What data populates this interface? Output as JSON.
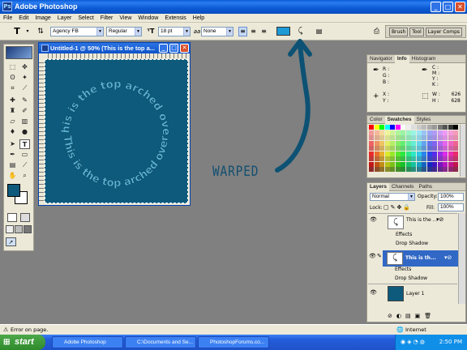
{
  "window": {
    "title": "Adobe Photoshop",
    "min": "_",
    "max": "□",
    "close": "✕"
  },
  "menu": [
    "File",
    "Edit",
    "Image",
    "Layer",
    "Select",
    "Filter",
    "View",
    "Window",
    "Extensis",
    "Help"
  ],
  "options": {
    "tool_glyph": "T",
    "font_family": "Agency FB",
    "font_style": "Regular",
    "font_size": "18 pt",
    "antialias": "None",
    "palette_buttons": [
      "Brush",
      "Tool",
      "Layer Comps"
    ]
  },
  "document": {
    "title": "Untitled-1 @ 50% (This is the top a..."
  },
  "warp": {
    "arc_text": "This is the top arched over",
    "annotation": "WARPED"
  },
  "info_panel": {
    "tabs": [
      "Navigator",
      "Info",
      "Histogram"
    ],
    "active": "Info",
    "labels_left": [
      "R :",
      "G :",
      "B :"
    ],
    "labels_right": [
      "C :",
      "M :",
      "Y :",
      "K :"
    ],
    "xy": [
      "X :",
      "Y :"
    ],
    "wh": [
      "W :",
      "H :"
    ],
    "w_value": "626",
    "h_value": "628"
  },
  "swatches_panel": {
    "tabs": [
      "Color",
      "Swatches",
      "Styles"
    ],
    "active": "Swatches"
  },
  "layers_panel": {
    "tabs": [
      "Layers",
      "Channels",
      "Paths"
    ],
    "active": "Layers",
    "blend_mode": "Normal",
    "opacity_label": "Opacity:",
    "opacity": "100%",
    "lock_label": "Lock:",
    "fill_label": "Fill:",
    "fill": "100%",
    "layers": [
      {
        "name": "This is the ...",
        "effects": "Effects",
        "shadow": "Drop Shadow",
        "selected": false
      },
      {
        "name": "This is th...",
        "effects": "Effects",
        "shadow": "Drop Shadow",
        "selected": true
      },
      {
        "name": "Layer 1",
        "selected": false
      }
    ]
  },
  "statusbar": {
    "text": "Error on page.",
    "zone": "Internet"
  },
  "taskbar": {
    "start": "start",
    "tasks": [
      "Adobe Photoshop",
      "C:\\Documents and Se...",
      "PhotoshopForums.co..."
    ],
    "clock": "2:50 PM"
  },
  "colors": {
    "accent": "#0e5a7c",
    "foreground": "#0e5a7c",
    "background": "#ffffff",
    "text_arc": "#5bb3d6",
    "selection": "#3168c6"
  }
}
